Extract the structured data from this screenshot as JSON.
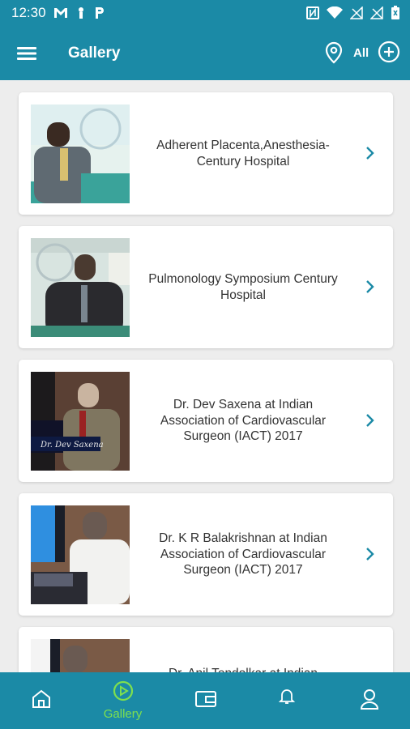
{
  "status": {
    "time": "12:30"
  },
  "header": {
    "title": "Gallery",
    "filter_label": "All"
  },
  "gallery": {
    "items": [
      {
        "title": "Adherent Placenta,Anesthesia-Century Hospital"
      },
      {
        "title": "Pulmonology Symposium Century Hospital"
      },
      {
        "title": "Dr. Dev Saxena at Indian Association of Cardiovascular Surgeon (IACT) 2017"
      },
      {
        "title": "Dr. K R Balakrishnan at Indian Association of Cardiovascular Surgeon (IACT) 2017"
      },
      {
        "title": "Dr. Anil Tendolkar at Indian"
      }
    ]
  },
  "bottom_nav": {
    "items": [
      {
        "icon": "home-icon"
      },
      {
        "icon": "play-circle-icon",
        "label": "Gallery",
        "active": true
      },
      {
        "icon": "wallet-icon"
      },
      {
        "icon": "bell-icon"
      },
      {
        "icon": "user-icon"
      }
    ]
  },
  "colors": {
    "primary": "#1b8aa6",
    "active_nav": "#7ee04e",
    "chevron": "#1b8aa6"
  }
}
